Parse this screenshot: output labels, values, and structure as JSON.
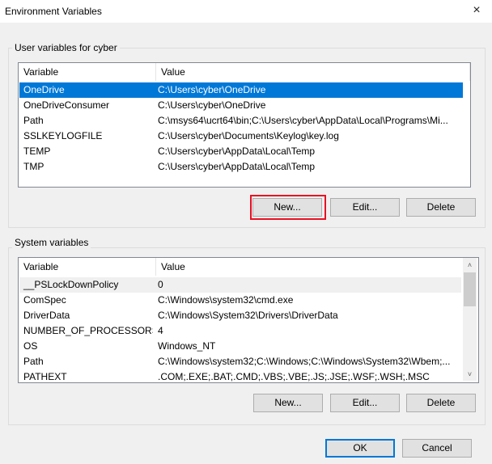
{
  "window": {
    "title": "Environment Variables",
    "close_icon": "×"
  },
  "user_vars": {
    "group_label": "User variables for cyber",
    "columns": [
      "Variable",
      "Value"
    ],
    "rows": [
      {
        "variable": "OneDrive",
        "value": "C:\\Users\\cyber\\OneDrive",
        "selected": true
      },
      {
        "variable": "OneDriveConsumer",
        "value": "C:\\Users\\cyber\\OneDrive"
      },
      {
        "variable": "Path",
        "value": "C:\\msys64\\ucrt64\\bin;C:\\Users\\cyber\\AppData\\Local\\Programs\\Mi..."
      },
      {
        "variable": "SSLKEYLOGFILE",
        "value": "C:\\Users\\cyber\\Documents\\Keylog\\key.log"
      },
      {
        "variable": "TEMP",
        "value": "C:\\Users\\cyber\\AppData\\Local\\Temp"
      },
      {
        "variable": "TMP",
        "value": "C:\\Users\\cyber\\AppData\\Local\\Temp"
      }
    ],
    "buttons": {
      "new": "New...",
      "edit": "Edit...",
      "delete": "Delete"
    }
  },
  "system_vars": {
    "group_label": "System variables",
    "columns": [
      "Variable",
      "Value"
    ],
    "rows": [
      {
        "variable": "__PSLockDownPolicy",
        "value": "0"
      },
      {
        "variable": "ComSpec",
        "value": "C:\\Windows\\system32\\cmd.exe"
      },
      {
        "variable": "DriverData",
        "value": "C:\\Windows\\System32\\Drivers\\DriverData"
      },
      {
        "variable": "NUMBER_OF_PROCESSORS",
        "value": "4"
      },
      {
        "variable": "OS",
        "value": "Windows_NT"
      },
      {
        "variable": "Path",
        "value": "C:\\Windows\\system32;C:\\Windows;C:\\Windows\\System32\\Wbem;..."
      },
      {
        "variable": "PATHEXT",
        "value": ".COM;.EXE;.BAT;.CMD;.VBS;.VBE;.JS;.JSE;.WSF;.WSH;.MSC"
      }
    ],
    "buttons": {
      "new": "New...",
      "edit": "Edit...",
      "delete": "Delete"
    },
    "scroll_up_icon": "˄",
    "scroll_down_icon": "˅"
  },
  "dialog_buttons": {
    "ok": "OK",
    "cancel": "Cancel"
  },
  "colors": {
    "selection": "#0078d7",
    "highlight_box": "#e81123"
  }
}
